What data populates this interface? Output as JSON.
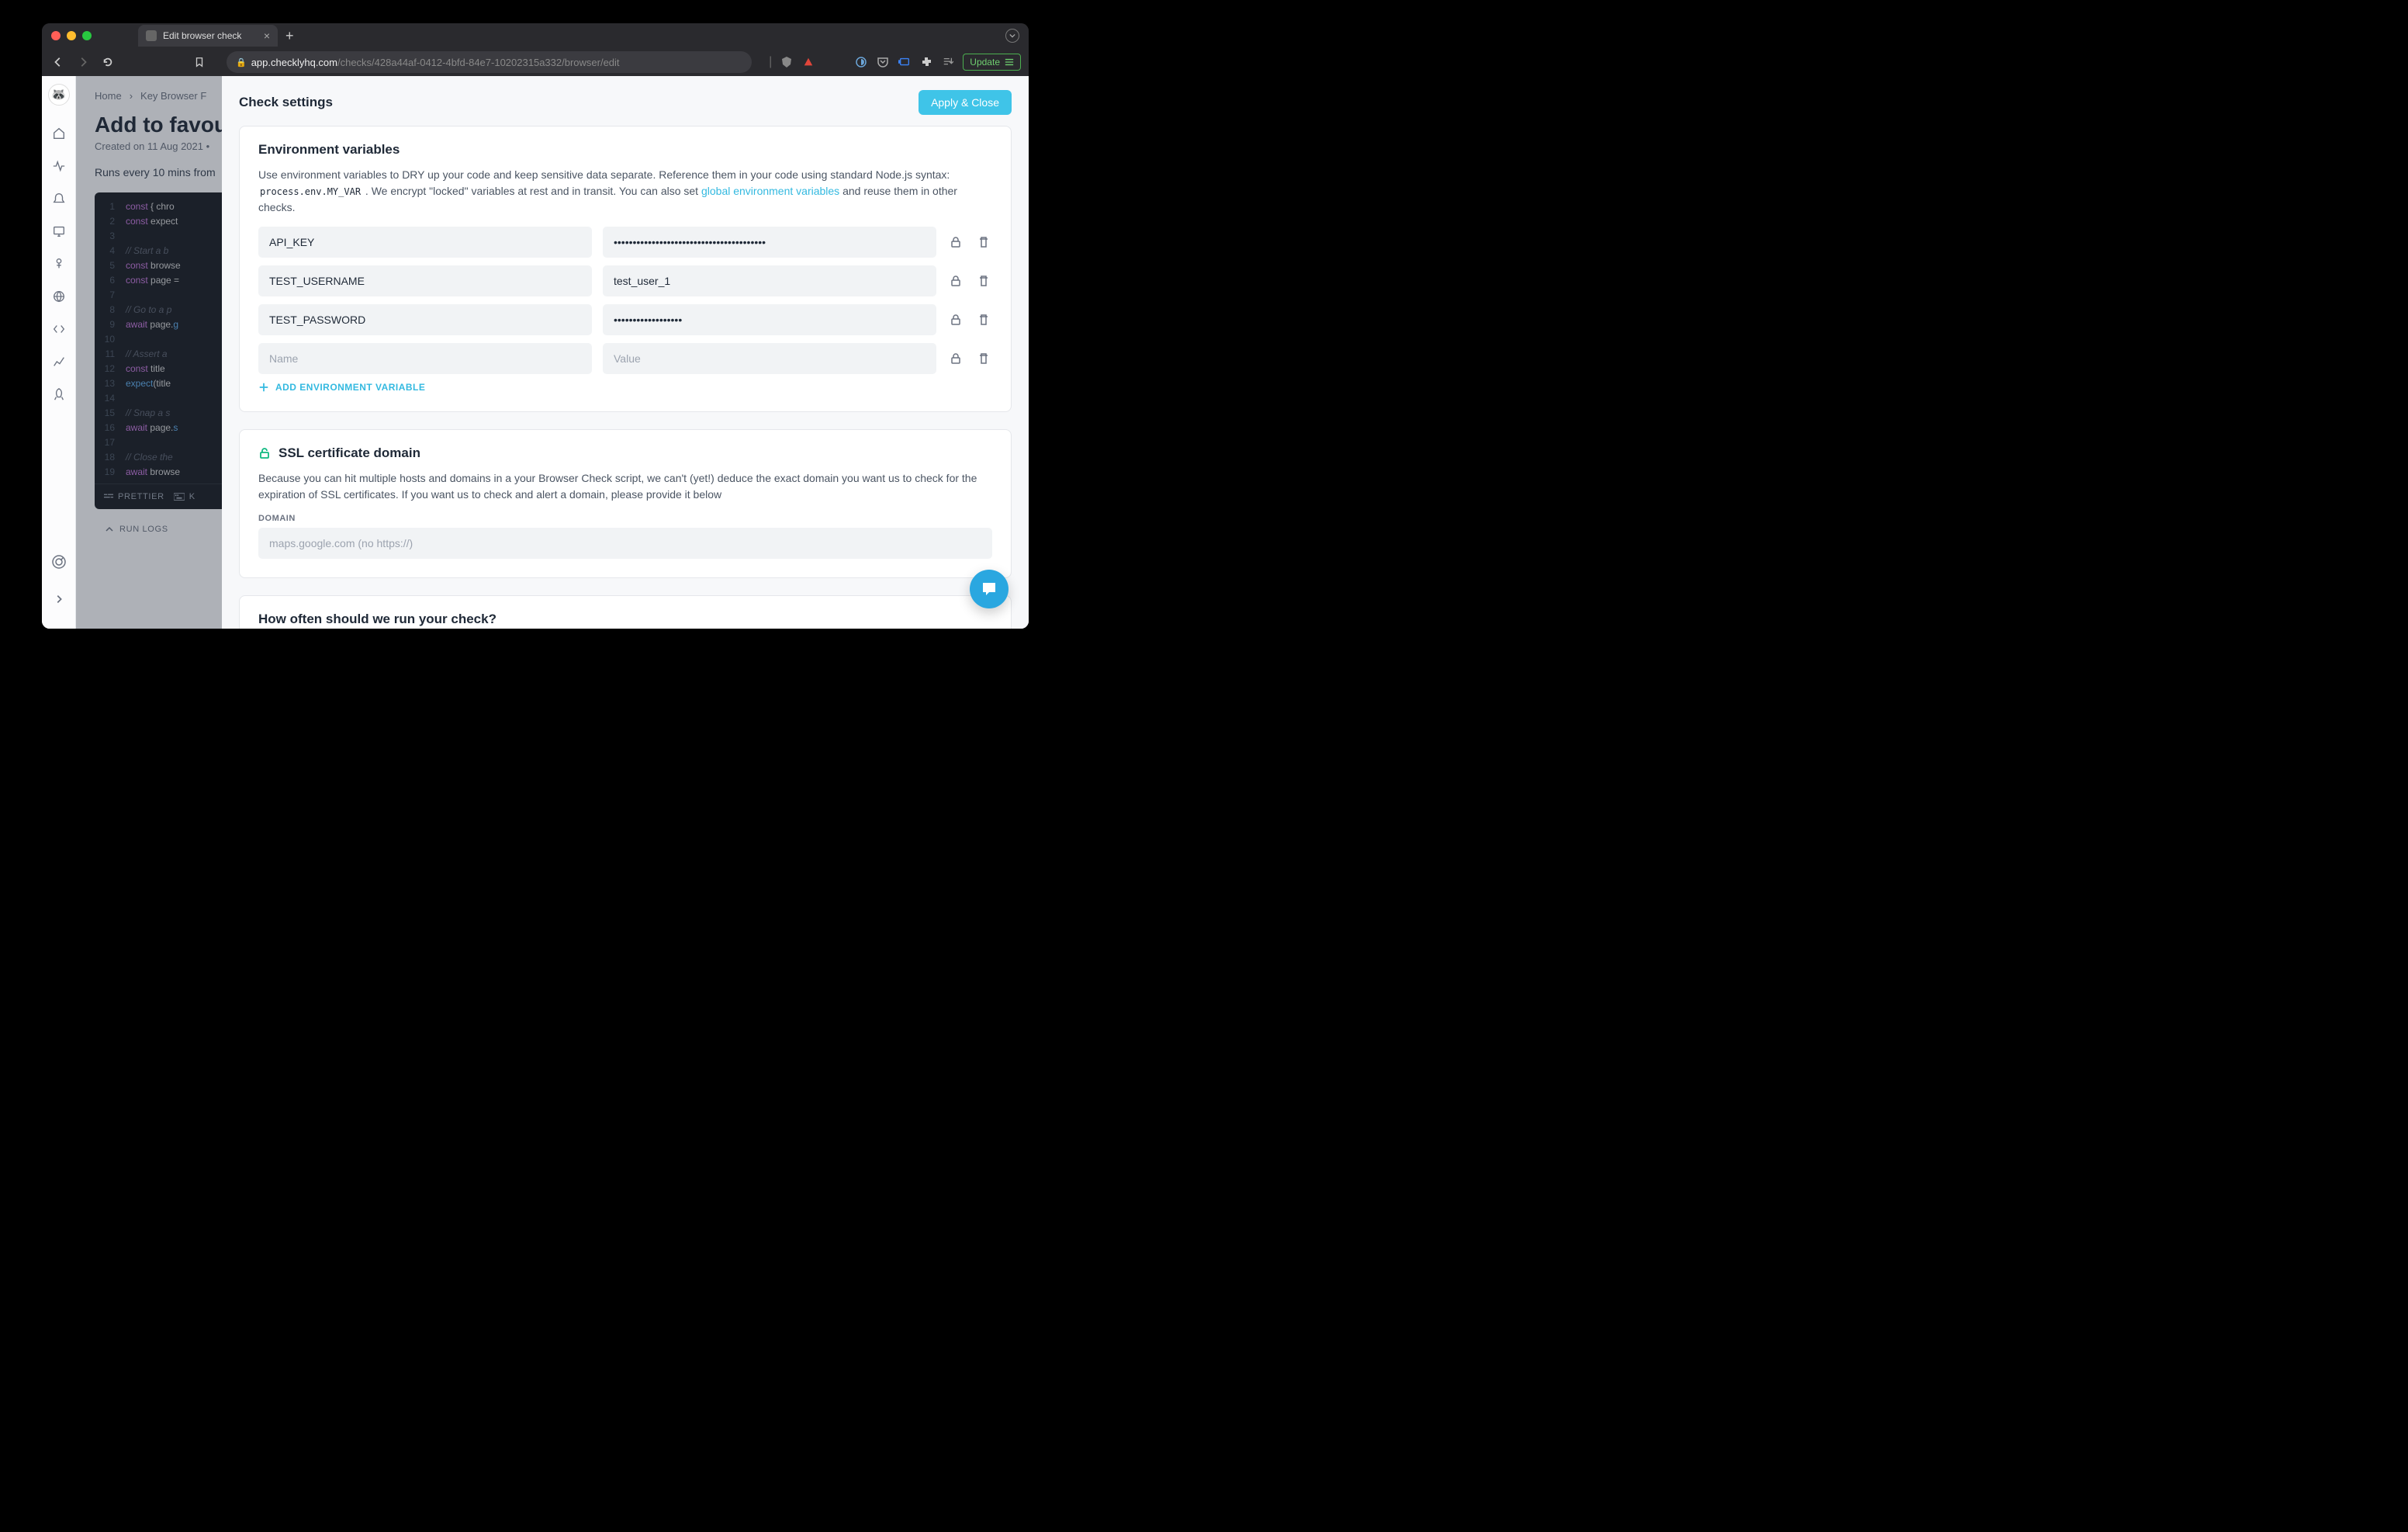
{
  "browser": {
    "tab_title": "Edit browser check",
    "url_domain": "app.checklyhq.com",
    "url_path": "/checks/428a44af-0412-4bfd-84e7-10202315a332/browser/edit",
    "update_label": "Update"
  },
  "breadcrumb": {
    "home": "Home",
    "item": "Key Browser F"
  },
  "page": {
    "title": "Add to favourit",
    "created": "Created on 11 Aug 2021",
    "schedule": "Runs every 10 mins from"
  },
  "code": {
    "lines": [
      {
        "n": "1",
        "html": "<span class='tok-kw'>const</span> { chro"
      },
      {
        "n": "2",
        "html": "<span class='tok-kw'>const</span> expect"
      },
      {
        "n": "3",
        "html": ""
      },
      {
        "n": "4",
        "html": "<span class='tok-cm'>// Start a b</span>"
      },
      {
        "n": "5",
        "html": "<span class='tok-kw'>const</span> browse"
      },
      {
        "n": "6",
        "html": "<span class='tok-kw'>const</span> page ="
      },
      {
        "n": "7",
        "html": ""
      },
      {
        "n": "8",
        "html": "<span class='tok-cm'>// Go to a p</span>"
      },
      {
        "n": "9",
        "html": "<span class='tok-kw'>await</span> page.<span class='tok-fn'>g</span>"
      },
      {
        "n": "10",
        "html": ""
      },
      {
        "n": "11",
        "html": "<span class='tok-cm'>// Assert a</span>"
      },
      {
        "n": "12",
        "html": "<span class='tok-kw'>const</span> title"
      },
      {
        "n": "13",
        "html": "<span class='tok-fn'>expect</span>(title"
      },
      {
        "n": "14",
        "html": ""
      },
      {
        "n": "15",
        "html": "<span class='tok-cm'>// Snap a s</span>"
      },
      {
        "n": "16",
        "html": "<span class='tok-kw'>await</span> page.<span class='tok-fn'>s</span>"
      },
      {
        "n": "17",
        "html": ""
      },
      {
        "n": "18",
        "html": "<span class='tok-cm'>// Close the</span>"
      },
      {
        "n": "19",
        "html": "<span class='tok-kw'>await</span> browse"
      }
    ],
    "prettier": "PRETTIER",
    "keyboard": "K",
    "run_logs": "RUN LOGS"
  },
  "panel": {
    "title": "Check settings",
    "apply": "Apply & Close"
  },
  "env": {
    "heading": "Environment variables",
    "desc_pre": "Use environment variables to DRY up your code and keep sensitive data separate. Reference them in your code using standard Node.js syntax: ",
    "code": "process.env.MY_VAR",
    "desc_mid": " . We encrypt \"locked\" variables at rest and in transit. You can also set ",
    "link": "global environment variables",
    "desc_post": " and reuse them in other checks.",
    "rows": [
      {
        "name": "API_KEY",
        "value": "••••••••••••••••••••••••••••••••••••••••"
      },
      {
        "name": "TEST_USERNAME",
        "value": "test_user_1"
      },
      {
        "name": "TEST_PASSWORD",
        "value": "••••••••••••••••••"
      }
    ],
    "name_placeholder": "Name",
    "value_placeholder": "Value",
    "add": "ADD ENVIRONMENT VARIABLE"
  },
  "ssl": {
    "heading": "SSL certificate domain",
    "desc": "Because you can hit multiple hosts and domains in a your Browser Check script, we can't (yet!) deduce the exact domain you want us to check for the expiration of SSL certificates. If you want us to check and alert a domain, please provide it below",
    "label": "DOMAIN",
    "placeholder": "maps.google.com (no https://)"
  },
  "frequency": {
    "heading": "How often should we run your check?"
  }
}
